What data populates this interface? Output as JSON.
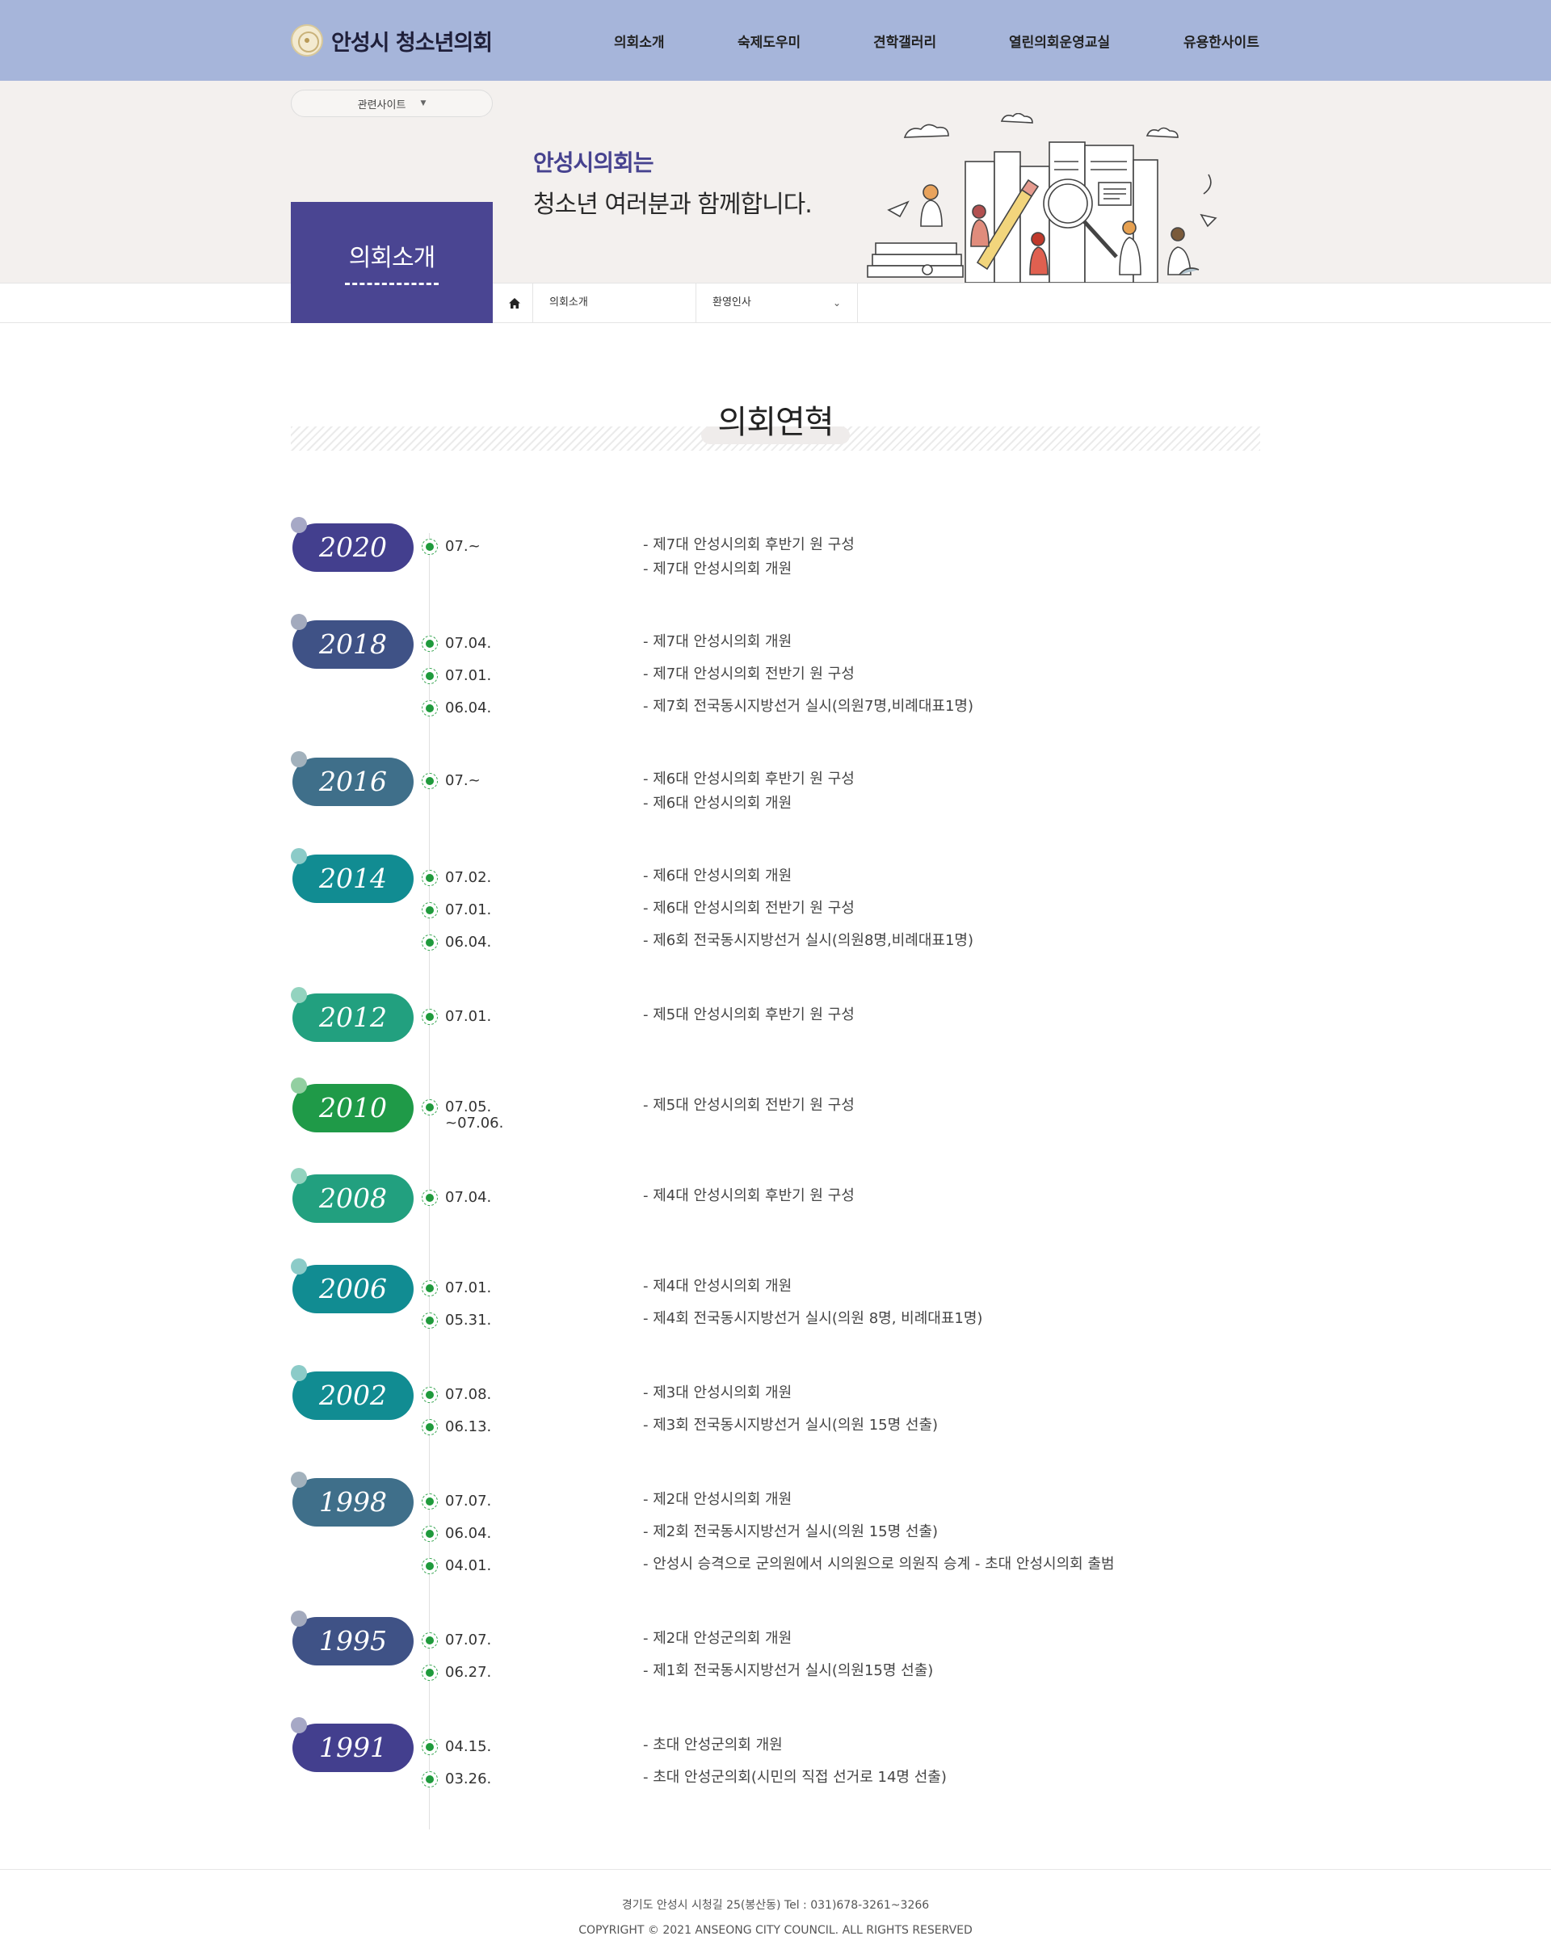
{
  "header": {
    "logo_text": "안성시 청소년의회",
    "nav": [
      "의회소개",
      "숙제도우미",
      "견학갤러리",
      "열린의회운영교실",
      "유용한사이트"
    ]
  },
  "visual": {
    "related_sites": "관련사이트",
    "line1": "안성시의회는",
    "line2": "청소년 여러분과 함께합니다."
  },
  "sub_box": {
    "title": "의회소개"
  },
  "location": {
    "home_icon": "home-icon",
    "depth1": "의회소개",
    "depth2": "환영인사"
  },
  "content": {
    "title": "의회연혁"
  },
  "colors": {
    "header_bg": "#a6b5da",
    "sub_box_bg": "#4a4592",
    "marker_green": "#1f9a3c"
  },
  "timeline": [
    {
      "year": "2020",
      "color": "#433f8e",
      "dot": "#a6a8c6",
      "events": [
        {
          "date": "07.~",
          "descs": [
            "- 제7대 안성시의회 후반기 원 구성",
            "- 제7대 안성시의회 개원"
          ]
        }
      ]
    },
    {
      "year": "2018",
      "color": "#3f5286",
      "dot": "#a3aabd",
      "events": [
        {
          "date": "07.04.",
          "descs": [
            "- 제7대 안성시의회 개원"
          ]
        },
        {
          "date": "07.01.",
          "descs": [
            "- 제7대 안성시의회 전반기 원 구성"
          ]
        },
        {
          "date": "06.04.",
          "descs": [
            "- 제7회 전국동시지방선거 실시(의원7명,비례대표1명)"
          ]
        }
      ]
    },
    {
      "year": "2016",
      "color": "#3f6f8a",
      "dot": "#a2b1bc",
      "events": [
        {
          "date": "07.~",
          "descs": [
            "- 제6대 안성시의회 후반기 원 구성",
            "- 제6대 안성시의회 개원"
          ]
        }
      ]
    },
    {
      "year": "2014",
      "color": "#118c92",
      "dot": "#8ccbc8",
      "events": [
        {
          "date": "07.02.",
          "descs": [
            "- 제6대 안성시의회 개원"
          ]
        },
        {
          "date": "07.01.",
          "descs": [
            "- 제6대 안성시의회 전반기 원 구성"
          ]
        },
        {
          "date": "06.04.",
          "descs": [
            "- 제6회 전국동시지방선거 실시(의원8명,비례대표1명)"
          ]
        }
      ]
    },
    {
      "year": "2012",
      "color": "#22a07f",
      "dot": "#93d3bf",
      "events": [
        {
          "date": "07.01.",
          "descs": [
            "- 제5대 안성시의회 후반기 원 구성"
          ]
        }
      ]
    },
    {
      "year": "2010",
      "color": "#1f9a48",
      "dot": "#92cfa1",
      "events": [
        {
          "date": "07.05.",
          "date2": "~07.06.",
          "descs": [
            "- 제5대 안성시의회 전반기 원 구성"
          ]
        }
      ]
    },
    {
      "year": "2008",
      "color": "#22a07f",
      "dot": "#93d3bf",
      "events": [
        {
          "date": "07.04.",
          "descs": [
            "- 제4대 안성시의회 후반기 원 구성"
          ]
        }
      ]
    },
    {
      "year": "2006",
      "color": "#118c92",
      "dot": "#8ccbc8",
      "events": [
        {
          "date": "07.01.",
          "descs": [
            "- 제4대 안성시의회 개원"
          ]
        },
        {
          "date": "05.31.",
          "descs": [
            "- 제4회 전국동시지방선거 실시(의원 8명, 비례대표1명)"
          ]
        }
      ]
    },
    {
      "year": "2002",
      "color": "#118c92",
      "dot": "#8ccbc8",
      "events": [
        {
          "date": "07.08.",
          "descs": [
            "- 제3대 안성시의회 개원"
          ]
        },
        {
          "date": "06.13.",
          "descs": [
            "- 제3회 전국동시지방선거 실시(의원 15명 선출)"
          ]
        }
      ]
    },
    {
      "year": "1998",
      "color": "#3f6f8a",
      "dot": "#a2b1bc",
      "events": [
        {
          "date": "07.07.",
          "descs": [
            "- 제2대 안성시의회 개원"
          ]
        },
        {
          "date": "06.04.",
          "descs": [
            "- 제2회 전국동시지방선거 실시(의원 15명 선출)"
          ]
        },
        {
          "date": "04.01.",
          "descs": [
            "- 안성시 승격으로 군의원에서 시의원으로 의원직 승계 - 초대 안성시의회 출범"
          ]
        }
      ]
    },
    {
      "year": "1995",
      "color": "#3f5286",
      "dot": "#a3aabd",
      "events": [
        {
          "date": "07.07.",
          "descs": [
            "- 제2대 안성군의회 개원"
          ]
        },
        {
          "date": "06.27.",
          "descs": [
            "- 제1회 전국동시지방선거 실시(의원15명 선출)"
          ]
        }
      ]
    },
    {
      "year": "1991",
      "color": "#433f8e",
      "dot": "#a6a8c6",
      "events": [
        {
          "date": "04.15.",
          "descs": [
            "- 초대 안성군의회 개원"
          ]
        },
        {
          "date": "03.26.",
          "descs": [
            "- 초대 안성군의회(시민의 직접 선거로 14명 선출)"
          ]
        }
      ]
    }
  ],
  "footer": {
    "address": "경기도 안성시 시청길 25(봉산동) Tel : 031)678-3261~3266",
    "copyright": "COPYRIGHT © 2021 ANSEONG CITY COUNCIL. ALL RIGHTS RESERVED"
  }
}
